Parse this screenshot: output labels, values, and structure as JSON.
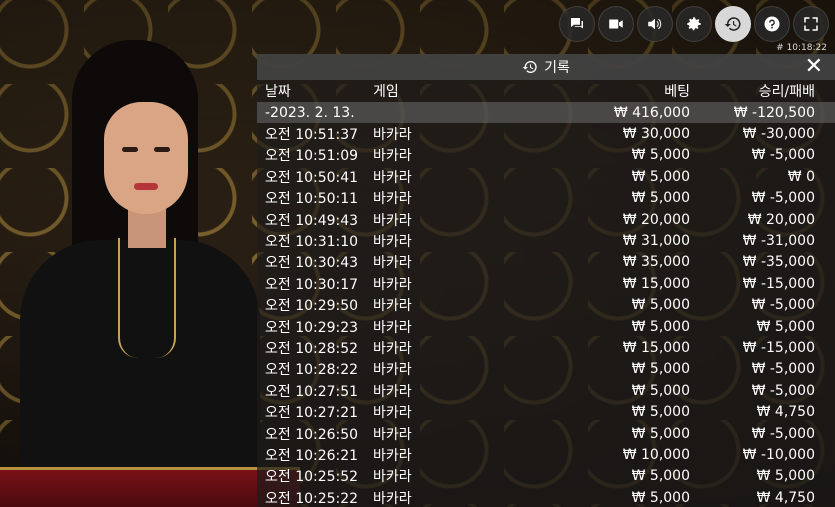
{
  "toolbar": {
    "buttons": [
      {
        "name": "chat-icon"
      },
      {
        "name": "video-icon"
      },
      {
        "name": "volume-icon"
      },
      {
        "name": "gear-icon"
      },
      {
        "name": "history-icon",
        "active": true
      },
      {
        "name": "help-icon"
      },
      {
        "name": "fullscreen-icon"
      }
    ],
    "clock": "# 10:18:22"
  },
  "history": {
    "title": "기록",
    "close": "✕",
    "columns": {
      "date": "날짜",
      "game": "게임",
      "bet": "베팅",
      "result": "승리/패배"
    },
    "summary": {
      "date": "-2023. 2. 13.",
      "bet": "₩ 416,000",
      "result": "₩ -120,500"
    },
    "rows": [
      {
        "time": "오전 10:51:37",
        "game": "바카라",
        "bet": "₩ 30,000",
        "result": "₩ -30,000"
      },
      {
        "time": "오전 10:51:09",
        "game": "바카라",
        "bet": "₩ 5,000",
        "result": "₩ -5,000"
      },
      {
        "time": "오전 10:50:41",
        "game": "바카라",
        "bet": "₩ 5,000",
        "result": "₩ 0"
      },
      {
        "time": "오전 10:50:11",
        "game": "바카라",
        "bet": "₩ 5,000",
        "result": "₩ -5,000"
      },
      {
        "time": "오전 10:49:43",
        "game": "바카라",
        "bet": "₩ 20,000",
        "result": "₩ 20,000"
      },
      {
        "time": "오전 10:31:10",
        "game": "바카라",
        "bet": "₩ 31,000",
        "result": "₩ -31,000"
      },
      {
        "time": "오전 10:30:43",
        "game": "바카라",
        "bet": "₩ 35,000",
        "result": "₩ -35,000"
      },
      {
        "time": "오전 10:30:17",
        "game": "바카라",
        "bet": "₩ 15,000",
        "result": "₩ -15,000"
      },
      {
        "time": "오전 10:29:50",
        "game": "바카라",
        "bet": "₩ 5,000",
        "result": "₩ -5,000"
      },
      {
        "time": "오전 10:29:23",
        "game": "바카라",
        "bet": "₩ 5,000",
        "result": "₩ 5,000"
      },
      {
        "time": "오전 10:28:52",
        "game": "바카라",
        "bet": "₩ 15,000",
        "result": "₩ -15,000"
      },
      {
        "time": "오전 10:28:22",
        "game": "바카라",
        "bet": "₩ 5,000",
        "result": "₩ -5,000"
      },
      {
        "time": "오전 10:27:51",
        "game": "바카라",
        "bet": "₩ 5,000",
        "result": "₩ -5,000"
      },
      {
        "time": "오전 10:27:21",
        "game": "바카라",
        "bet": "₩ 5,000",
        "result": "₩ 4,750"
      },
      {
        "time": "오전 10:26:50",
        "game": "바카라",
        "bet": "₩ 5,000",
        "result": "₩ -5,000"
      },
      {
        "time": "오전 10:26:21",
        "game": "바카라",
        "bet": "₩ 10,000",
        "result": "₩ -10,000"
      },
      {
        "time": "오전 10:25:52",
        "game": "바카라",
        "bet": "₩ 5,000",
        "result": "₩ 5,000"
      },
      {
        "time": "오전 10:25:22",
        "game": "바카라",
        "bet": "₩ 5,000",
        "result": "₩ 4,750"
      }
    ]
  }
}
